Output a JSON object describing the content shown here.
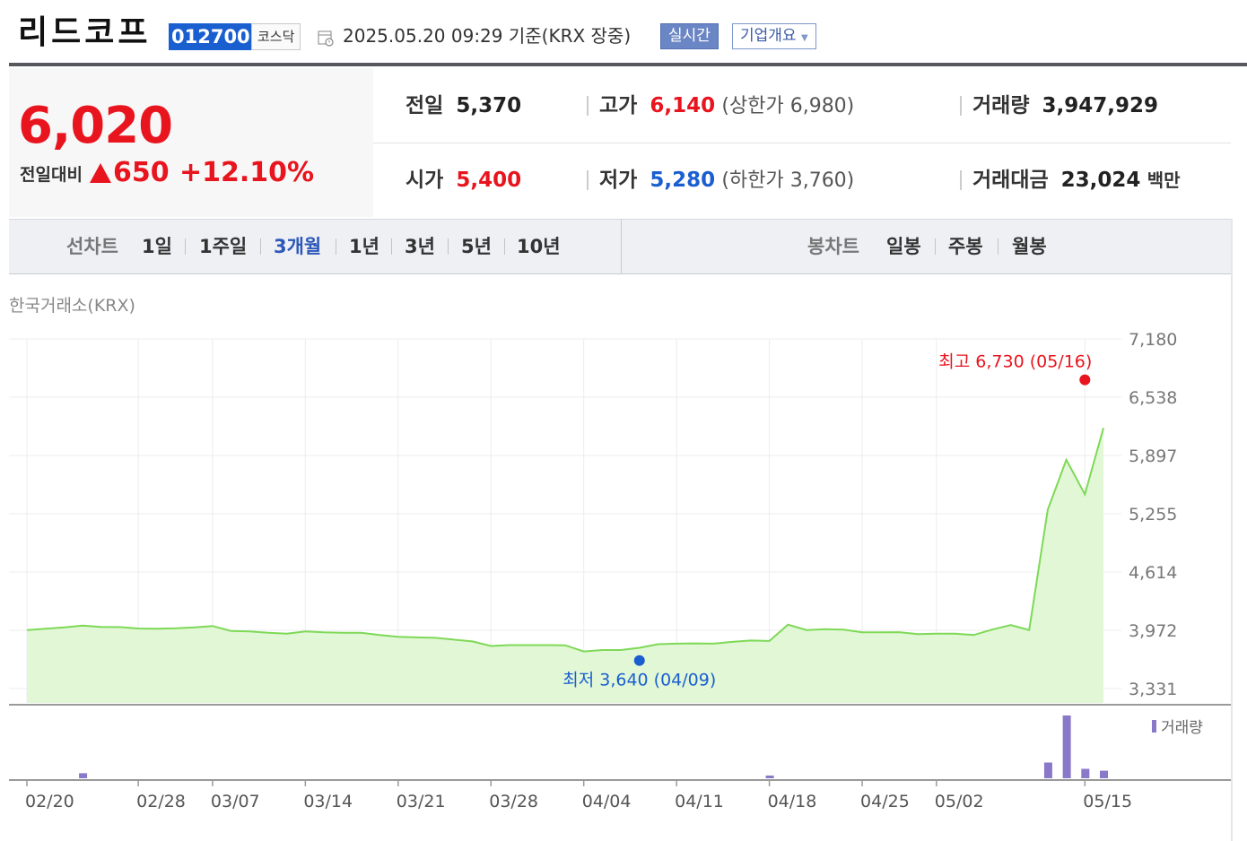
{
  "header": {
    "name": "리드코프",
    "code": "012700",
    "market": "코스닥",
    "datetime": "2025.05.20 09:29  기준(KRX 장중)",
    "btn_realtime": "실시간",
    "btn_company": "기업개요"
  },
  "price": {
    "current": "6,020",
    "prev_label": "전일대비",
    "change": "650",
    "rate": "+12.10%"
  },
  "stats": {
    "prev_label": "전일",
    "prev": "5,370",
    "high_label": "고가",
    "high": "6,140",
    "upper_limit": "(상한가 6,980)",
    "volume_label": "거래량",
    "volume": "3,947,929",
    "open_label": "시가",
    "open": "5,400",
    "low_label": "저가",
    "low": "5,280",
    "lower_limit": "(하한가 3,760)",
    "amount_label": "거래대금",
    "amount": "23,024",
    "amount_unit": "백만"
  },
  "tabs": {
    "line_chart": "선차트",
    "periods": [
      "1일",
      "1주일",
      "3개월",
      "1년",
      "3년",
      "5년",
      "10년"
    ],
    "active_period": "3개월",
    "candle_chart": "봉차트",
    "candles": [
      "일봉",
      "주봉",
      "월봉"
    ]
  },
  "exchange": "한국거래소(KRX)",
  "colors": {
    "up": "#e8141e",
    "down": "#1a5fd0",
    "line": "#7ed957",
    "area": "#dff6d2",
    "volume": "#8a78c8"
  },
  "chart_data": {
    "type": "area",
    "ylim": [
      3331,
      7180
    ],
    "y_ticks": [
      "7,180",
      "6,538",
      "5,897",
      "5,255",
      "4,614",
      "3,972",
      "3,331"
    ],
    "x_ticks": [
      "02/20",
      "02/28",
      "03/07",
      "03/14",
      "03/21",
      "03/28",
      "04/04",
      "04/11",
      "04/18",
      "04/25",
      "05/02",
      "05/15"
    ],
    "x_tick_indexes": [
      0,
      6,
      10,
      15,
      20,
      25,
      30,
      35,
      40,
      45,
      49,
      57
    ],
    "series": [
      {
        "values": [
          3975,
          3990,
          4005,
          4025,
          4010,
          4008,
          3992,
          3990,
          3995,
          4005,
          4020,
          3965,
          3960,
          3945,
          3935,
          3960,
          3950,
          3945,
          3945,
          3920,
          3900,
          3895,
          3890,
          3870,
          3850,
          3800,
          3810,
          3810,
          3810,
          3808,
          3740,
          3755,
          3755,
          3780,
          3820,
          3825,
          3828,
          3825,
          3845,
          3860,
          3855,
          4035,
          3975,
          3985,
          3980,
          3950,
          3950,
          3952,
          3930,
          3935,
          3935,
          3920,
          3980,
          4030,
          3975,
          5300,
          5850,
          5470,
          6200
        ],
        "dates": [
          "02/20",
          "02/21",
          "02/24",
          "02/25",
          "02/26",
          "02/27",
          "02/28",
          "03/04",
          "03/05",
          "03/06",
          "03/07",
          "03/10",
          "03/11",
          "03/12",
          "03/13",
          "03/14",
          "03/17",
          "03/18",
          "03/19",
          "03/20",
          "03/21",
          "03/24",
          "03/25",
          "03/26",
          "03/27",
          "03/28",
          "03/31",
          "04/01",
          "04/02",
          "04/03",
          "04/04",
          "04/07",
          "04/08",
          "04/09",
          "04/10",
          "04/11",
          "04/14",
          "04/15",
          "04/16",
          "04/17",
          "04/18",
          "04/21",
          "04/22",
          "04/23",
          "04/24",
          "04/25",
          "04/28",
          "04/29",
          "04/30",
          "05/02",
          "05/07",
          "05/08",
          "05/09",
          "05/12",
          "05/13",
          "05/14",
          "05/15",
          "05/16",
          "05/19"
        ]
      }
    ],
    "max_annotation": {
      "label": "최고 6,730 (05/16)",
      "value": 6730,
      "index": 57
    },
    "min_annotation": {
      "label": "최저 3,640 (04/09)",
      "value": 3640,
      "index": 33
    },
    "volume": {
      "label": "거래량",
      "values": [
        0,
        0,
        0,
        0.08,
        0,
        0,
        0,
        0,
        0,
        0,
        0,
        0,
        0,
        0,
        0,
        0,
        0,
        0,
        0,
        0,
        0,
        0,
        0,
        0,
        0,
        0,
        0,
        0,
        0,
        0,
        0,
        0,
        0,
        0,
        0,
        0,
        0,
        0,
        0,
        0,
        0.04,
        0,
        0,
        0,
        0,
        0,
        0,
        0,
        0,
        0,
        0,
        0,
        0,
        0,
        0,
        0.25,
        1.0,
        0.15,
        0.12
      ]
    },
    "grid": true
  }
}
